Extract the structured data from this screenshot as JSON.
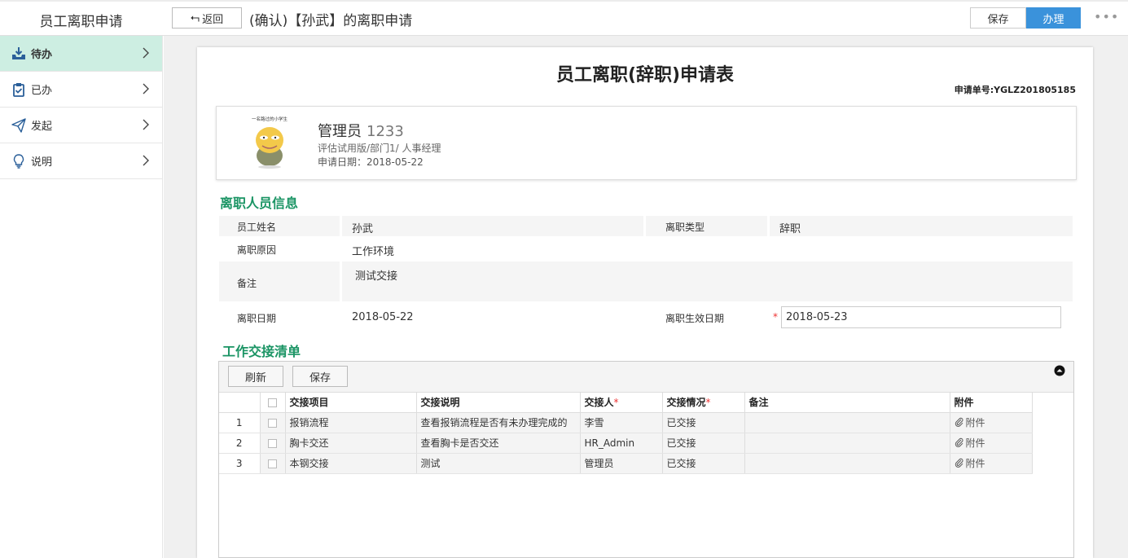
{
  "app": {
    "title": "员工离职申请"
  },
  "header": {
    "back_label": "返回",
    "doc_title": "(确认)【孙武】的离职申请",
    "save_label": "保存",
    "handle_label": "办理",
    "more_icon": "more-dots-icon",
    "accent_color": "#3a92db"
  },
  "sidebar": {
    "items": [
      {
        "label": "待办",
        "icon": "inbox-download-icon",
        "active": true
      },
      {
        "label": "已办",
        "icon": "clipboard-check-icon",
        "active": false
      },
      {
        "label": "发起",
        "icon": "paper-plane-icon",
        "active": false
      },
      {
        "label": "说明",
        "icon": "lightbulb-icon",
        "active": false
      }
    ],
    "active_color": "#cdeee2"
  },
  "form": {
    "title": "员工离职(辞职)申请表",
    "number_label": "申请单号:",
    "number": "YGLZ201805185",
    "applicant": {
      "name": "管理员",
      "code": "1233",
      "dept": "评估试用版/部门1/ 人事经理",
      "date_label": "申请日期：",
      "date": "2018-05-22",
      "avatar_caption": "一名路过的小学生"
    },
    "section1_title": "离职人员信息",
    "fields": {
      "employee_name_label": "员工姓名",
      "employee_name": "孙武",
      "leave_type_label": "离职类型",
      "leave_type": "辞职",
      "reason_label": "离职原因",
      "reason": "工作环境",
      "remark_label": "备注",
      "remark": "测试交接",
      "leave_date_label": "离职日期",
      "leave_date": "2018-05-22",
      "effective_date_label": "离职生效日期",
      "effective_date": "2018-05-23",
      "required_mark": "*"
    },
    "section2_title": "工作交接清单"
  },
  "handover": {
    "refresh_label": "刷新",
    "save_label": "保存",
    "columns": [
      "交接项目",
      "交接说明",
      "交接人",
      "交接情况",
      "备注",
      "附件"
    ],
    "required_mark": "*",
    "rows": [
      {
        "num": "1",
        "item": "报销流程",
        "desc": "查看报销流程是否有未办理完成的",
        "person": "李雪",
        "status": "已交接",
        "remark": "",
        "attach": "附件"
      },
      {
        "num": "2",
        "item": "胸卡交还",
        "desc": "查看胸卡是否交还",
        "person": "HR_Admin",
        "status": "已交接",
        "remark": "",
        "attach": "附件"
      },
      {
        "num": "3",
        "item": "本钢交接",
        "desc": "测试",
        "person": "管理员",
        "status": "已交接",
        "remark": "",
        "attach": "附件"
      }
    ]
  }
}
